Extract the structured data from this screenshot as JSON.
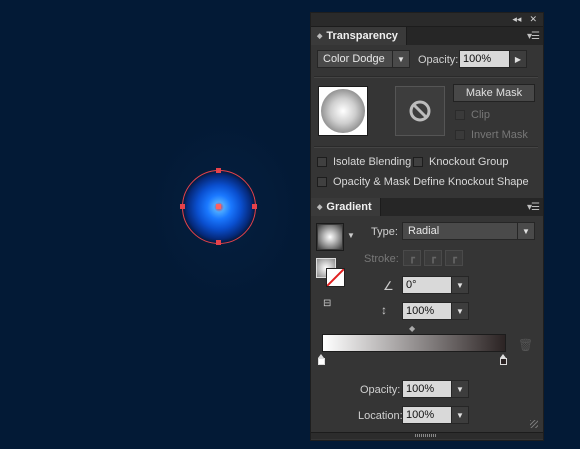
{
  "dock": {
    "collapse_glyph": "◂◂",
    "close_glyph": "✕"
  },
  "transparency": {
    "title": "Transparency",
    "blend_mode": "Color Dodge",
    "opacity_label": "Opacity:",
    "opacity_value": "100%",
    "make_mask_label": "Make Mask",
    "clip_label": "Clip",
    "invert_mask_label": "Invert Mask",
    "isolate_blending_label": "Isolate Blending",
    "knockout_group_label": "Knockout Group",
    "opacity_mask_label": "Opacity & Mask Define Knockout Shape"
  },
  "gradient": {
    "title": "Gradient",
    "type_label": "Type:",
    "type_value": "Radial",
    "stroke_label": "Stroke:",
    "angle_value": "0°",
    "aspect_value": "100%",
    "opacity_label": "Opacity:",
    "opacity_value": "100%",
    "location_label": "Location:",
    "location_value": "100%",
    "start_color": "#ffffff",
    "end_color": "#2b2323"
  },
  "canvas": {
    "background": "#031a36",
    "selection_color": "#e6424b"
  }
}
